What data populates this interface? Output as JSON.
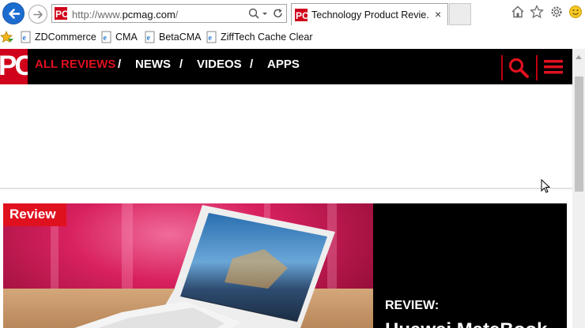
{
  "browser": {
    "address_url_prefix": "http://www.",
    "address_url_domain": "pcmag.com",
    "address_url_suffix": "/",
    "tab_title": "Technology Product Revie...",
    "tab_close": "×",
    "favorites": [
      {
        "label": "ZDCommerce"
      },
      {
        "label": "CMA"
      },
      {
        "label": "BetaCMA"
      },
      {
        "label": "ZiffTech Cache Clear"
      }
    ]
  },
  "site": {
    "logo_text": "PC",
    "nav": {
      "items": [
        {
          "label": "ALL REVIEWS",
          "active": true
        },
        {
          "label": "NEWS"
        },
        {
          "label": "VIDEOS"
        },
        {
          "label": "APPS"
        }
      ],
      "separator": "/"
    },
    "hero": {
      "badge": "Review",
      "kicker": "REVIEW:",
      "title": "Huawei MateBook"
    }
  },
  "colors": {
    "brand_red": "#e0111f",
    "nav_bg": "#000000",
    "link_blue": "#1c6cd0"
  },
  "icons": [
    "back-arrow-icon",
    "forward-arrow-icon",
    "search-icon",
    "refresh-icon",
    "home-icon",
    "star-icon",
    "gear-icon",
    "smiley-icon",
    "hamburger-menu-icon",
    "mouse-cursor-icon"
  ]
}
